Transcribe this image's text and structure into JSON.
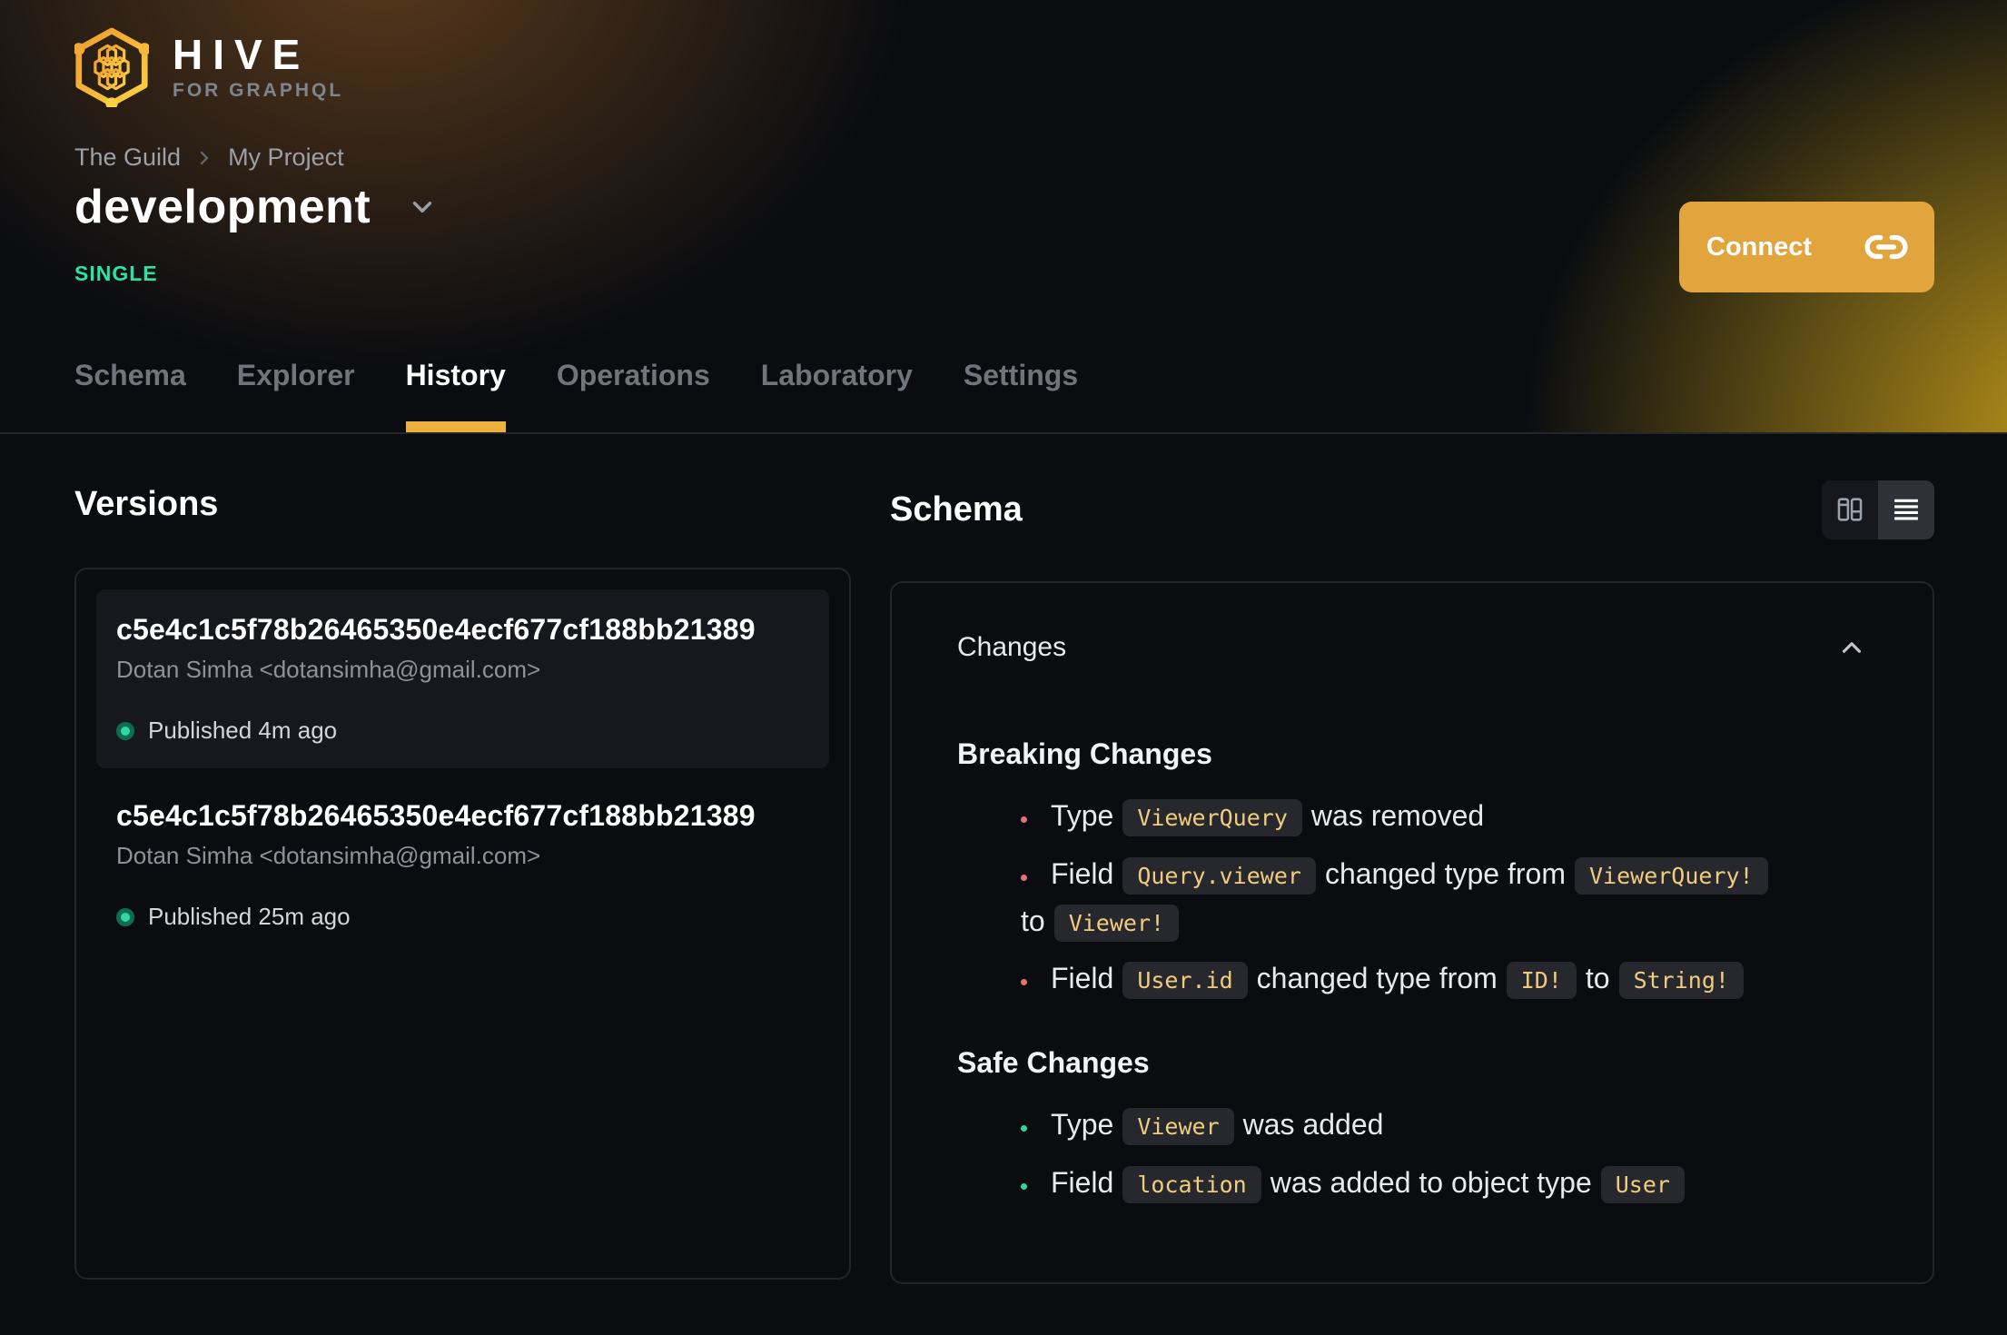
{
  "colors": {
    "accent_amber": "#edb13f",
    "connect_bg": "#e2a43d",
    "badge_green": "#2be3a4",
    "published_dot": "#2fd9a2",
    "breaking_bullet": "#e8707a",
    "safe_bullet": "#34d399",
    "chip_text": "#f0cd7e",
    "chip_bg": "#26282d"
  },
  "header": {
    "logo": {
      "title": "HIVE",
      "subtitle": "FOR GRAPHQL",
      "icon": "hive-hexagon-logo"
    },
    "breadcrumb": {
      "org": "The Guild",
      "project": "My Project"
    },
    "target": {
      "name": "development",
      "badge": "SINGLE"
    },
    "connect": {
      "label": "Connect",
      "icon": "link-icon"
    },
    "tabs": [
      {
        "label": "Schema",
        "active": false
      },
      {
        "label": "Explorer",
        "active": false
      },
      {
        "label": "History",
        "active": true
      },
      {
        "label": "Operations",
        "active": false
      },
      {
        "label": "Laboratory",
        "active": false
      },
      {
        "label": "Settings",
        "active": false
      }
    ]
  },
  "versions": {
    "heading": "Versions",
    "items": [
      {
        "hash": "c5e4c1c5f78b26465350e4ecf677cf188bb21389",
        "author": "Dotan Simha <dotansimha@gmail.com>",
        "status": "Published 4m ago",
        "selected": true
      },
      {
        "hash": "c5e4c1c5f78b26465350e4ecf677cf188bb21389",
        "author": "Dotan Simha <dotansimha@gmail.com>",
        "status": "Published 25m ago",
        "selected": false
      }
    ]
  },
  "schema_panel": {
    "heading": "Schema",
    "view_toggle": {
      "left_icon": "columns-view-icon",
      "right_icon": "list-view-icon",
      "active": "list"
    },
    "changes": {
      "title": "Changes",
      "breaking": {
        "title": "Breaking Changes",
        "items": [
          {
            "segments": [
              {
                "text": "Type"
              },
              {
                "code": "ViewerQuery"
              },
              {
                "text": "was removed"
              }
            ]
          },
          {
            "segments": [
              {
                "text": "Field"
              },
              {
                "code": "Query.viewer"
              },
              {
                "text": "changed type from"
              },
              {
                "code": "ViewerQuery!"
              },
              {
                "text": "to"
              },
              {
                "code": "Viewer!"
              }
            ]
          },
          {
            "segments": [
              {
                "text": "Field"
              },
              {
                "code": "User.id"
              },
              {
                "text": "changed type from"
              },
              {
                "code": "ID!"
              },
              {
                "text": "to"
              },
              {
                "code": "String!"
              }
            ]
          }
        ]
      },
      "safe": {
        "title": "Safe Changes",
        "items": [
          {
            "segments": [
              {
                "text": "Type"
              },
              {
                "code": "Viewer"
              },
              {
                "text": "was added"
              }
            ]
          },
          {
            "segments": [
              {
                "text": "Field"
              },
              {
                "code": "location"
              },
              {
                "text": "was added to object type"
              },
              {
                "code": "User"
              }
            ]
          }
        ]
      }
    }
  }
}
